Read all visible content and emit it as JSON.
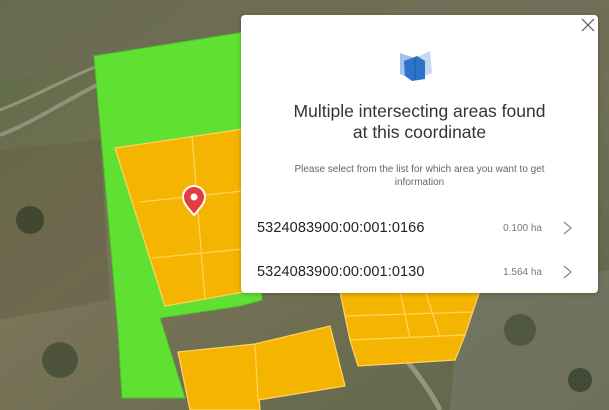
{
  "popup": {
    "title_line1": "Multiple intersecting areas found",
    "title_line2": "at this coordinate",
    "subtitle_line1": "Please select from the list for which area you want to get",
    "subtitle_line2": "information",
    "icons": {
      "close": "close-icon",
      "header": "layers-icon",
      "row": "chevron-right-icon"
    },
    "areas": [
      {
        "code": "5324083900:00:001:0166",
        "size": "0.100 ha"
      },
      {
        "code": "5324083900:00:001:0130",
        "size": "1.564 ha"
      }
    ]
  },
  "map": {
    "marker_icon": "map-pin-icon",
    "colors": {
      "selected_area": "#5fe033",
      "parcels": "#f5b400",
      "parcel_border": "#ffd25a",
      "marker": "#e23c3c",
      "accent_icon": "#2b74c9"
    }
  }
}
